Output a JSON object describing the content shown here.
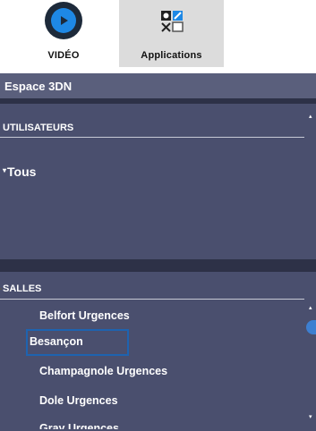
{
  "toolbar": {
    "video_label": "VIDÉO",
    "apps_label": "Applications",
    "video_icon": "play-circle-icon",
    "apps_icon": "apps-grid-icon"
  },
  "panel": {
    "title": "Espace 3DN"
  },
  "users": {
    "header": "UTILISATEURS",
    "root_item": "Tous"
  },
  "rooms": {
    "header": "SALLES",
    "items": [
      "Belfort Urgences",
      "Besançon",
      "Champagnole Urgences",
      "Dole Urgences",
      "Gray Urgences"
    ],
    "selected": "Besançon"
  },
  "colors": {
    "panel_bg": "#4a4f6e",
    "title_bg": "#5a5f7c",
    "accent": "#1e88e5",
    "selection_border": "#1e63b0"
  }
}
